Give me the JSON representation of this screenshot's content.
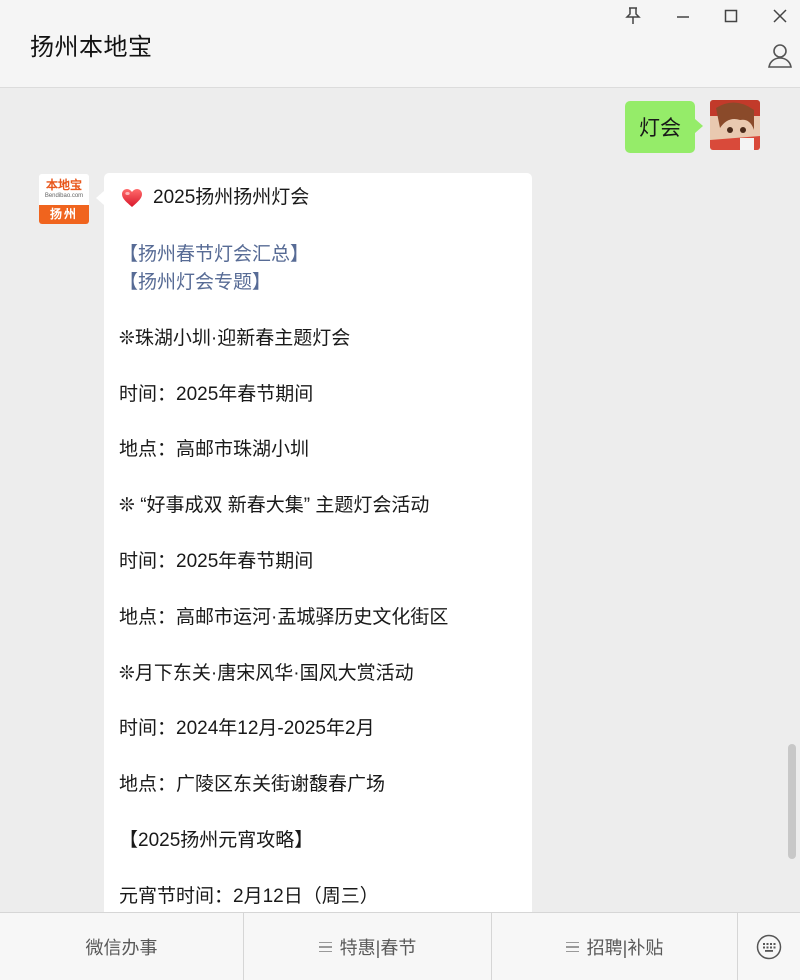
{
  "app": {
    "title": "扬州本地宝"
  },
  "window_controls": [
    "pin-icon",
    "minimize-icon",
    "maximize-icon",
    "close-icon"
  ],
  "user_message": {
    "text": "灯会"
  },
  "bot_avatar": {
    "brand": "本地宝",
    "domain": "Bendibao.com",
    "city": "扬州"
  },
  "bot_message": {
    "title": "2025扬州扬州灯会",
    "link_1": "【扬州春节灯会汇总】",
    "link_2": "【扬州灯会专题】",
    "event1_name": "❊珠湖小圳·迎新春主题灯会",
    "event1_time": "时间：2025年春节期间",
    "event1_place": "地点：高邮市珠湖小圳",
    "event2_name": "❊ “好事成双 新春大集” 主题灯会活动",
    "event2_time": "时间：2025年春节期间",
    "event2_place": "地点：高邮市运河·盂城驿历史文化街区",
    "event3_name": "❊月下东关·唐宋风华·国风大赏活动",
    "event3_time": "时间：2024年12月-2025年2月",
    "event3_place": "地点：广陵区东关街谢馥春广场",
    "guide": "【2025扬州元宵攻略】",
    "lantern_festival": "元宵节时间：2月12日（周三）"
  },
  "bottom_menu": {
    "item1": "微信办事",
    "item2": "特惠|春节",
    "item3": "招聘|补贴"
  },
  "colors": {
    "self_bubble": "#95ec69",
    "link": "#576b95",
    "brand_orange": "#f0641e"
  }
}
